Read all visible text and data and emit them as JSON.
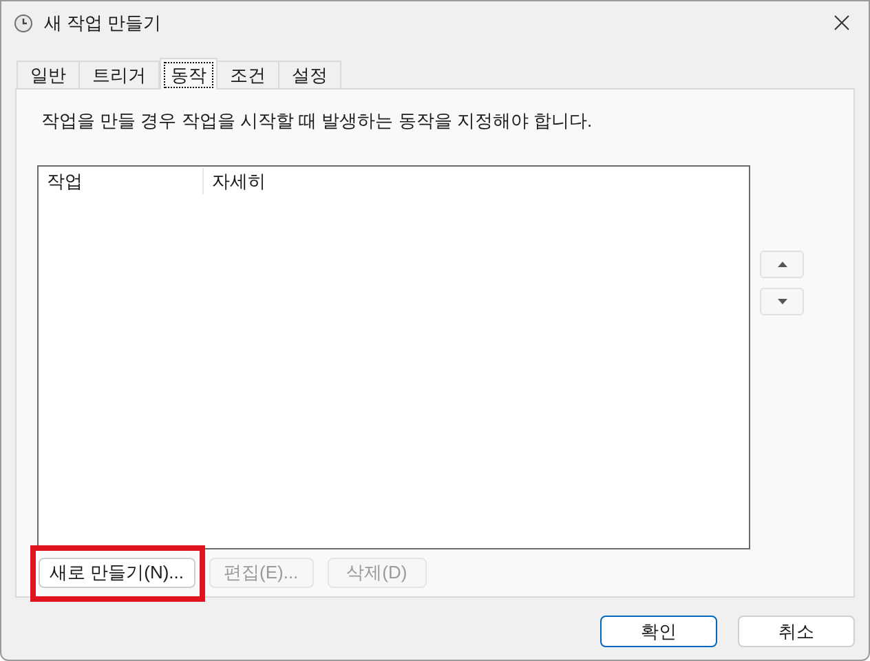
{
  "window": {
    "title": "새 작업 만들기"
  },
  "tabs": [
    {
      "label": "일반",
      "selected": false
    },
    {
      "label": "트리거",
      "selected": false
    },
    {
      "label": "동작",
      "selected": true
    },
    {
      "label": "조건",
      "selected": false
    },
    {
      "label": "설정",
      "selected": false
    }
  ],
  "description": "작업을 만들 경우 작업을 시작할 때 발생하는 동작을 지정해야 합니다.",
  "table": {
    "columns": [
      "작업",
      "자세히"
    ]
  },
  "action_buttons": [
    {
      "label": "새로 만들기(N)...",
      "disabled": false,
      "highlighted": true
    },
    {
      "label": "편집(E)...",
      "disabled": true,
      "highlighted": false
    },
    {
      "label": "삭제(D)",
      "disabled": true,
      "highlighted": false
    }
  ],
  "dialog_buttons": [
    {
      "label": "확인",
      "default": true
    },
    {
      "label": "취소",
      "default": false
    }
  ]
}
